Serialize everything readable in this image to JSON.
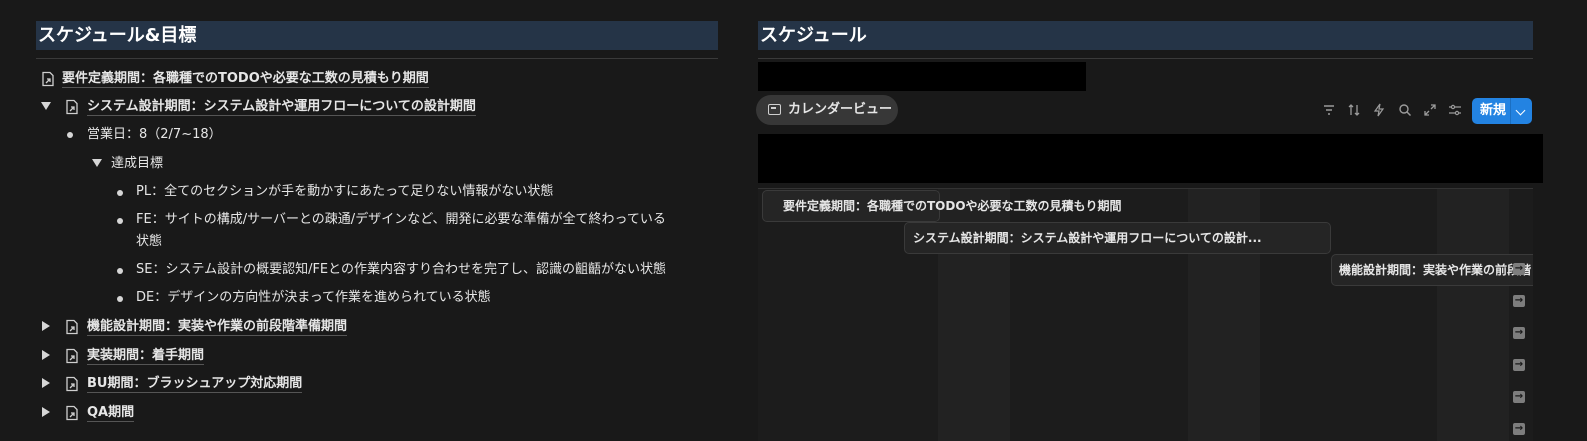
{
  "left": {
    "heading": "スケジュール&目標",
    "items": [
      {
        "label": "要件定義期間：各職種でのTODOや必要な工数の見積もり期間"
      },
      {
        "label": "システム設計期間：システム設計や運用フローについての設計期間"
      },
      {
        "label": "営業日：8（2/7~18）"
      },
      {
        "label": "達成目標"
      },
      {
        "label": "PL：全てのセクションが手を動かすにあたって足りない情報がない状態"
      },
      {
        "label": "FE：サイトの構成/サーバーとの疎通/デザインなど、開発に必要な準備が全て終わっている"
      },
      {
        "label": "状態"
      },
      {
        "label": "SE：システム設計の概要認知/FEとの作業内容すり合わせを完了し、認識の齟齬がない状態"
      },
      {
        "label": "DE：デザインの方向性が決まって作業を進められている状態"
      },
      {
        "label": "機能設計期間：実装や作業の前段階準備期間"
      },
      {
        "label": "実装期間：着手期間"
      },
      {
        "label": "BU期間：ブラッシュアップ対応期間"
      },
      {
        "label": "QA期間"
      }
    ]
  },
  "right": {
    "heading": "スケジュール",
    "view_label": "カレンダービュー",
    "view_icon": "calendar-icon",
    "toolbar": {
      "icons": [
        "filter-icon",
        "sort-icon",
        "lightning-icon",
        "search-icon",
        "expand-icon",
        "settings-icon"
      ],
      "new_label": "新規"
    },
    "timeline": {
      "bars": [
        {
          "label": "要件定義期間：各職種でのTODOや必要な工数の見積もり期間"
        },
        {
          "label": "システム設計期間：システム設計や運用フローについての設計..."
        },
        {
          "label": "機能設計期間：実装や作業の前段階"
        }
      ],
      "arrow_glyph": "→"
    }
  }
}
